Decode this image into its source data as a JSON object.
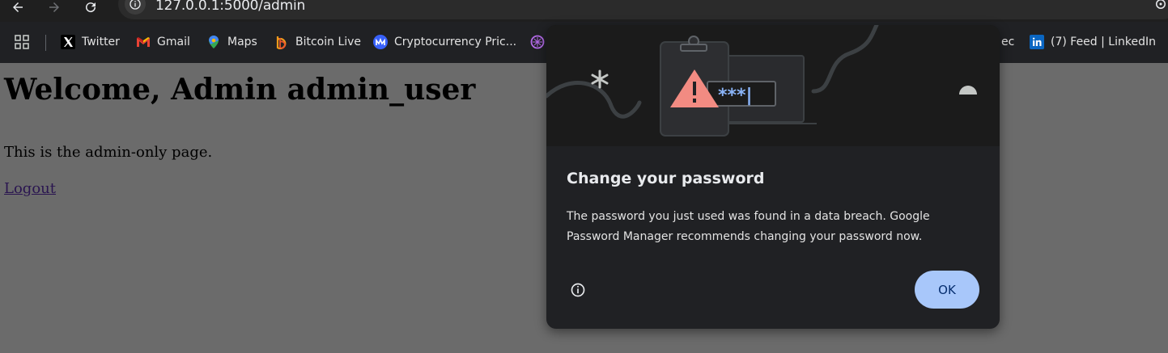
{
  "browser": {
    "url": "127.0.0.1:5000/admin"
  },
  "bookmarks": [
    {
      "label": "Twitter",
      "icon": "x-icon"
    },
    {
      "label": "Gmail",
      "icon": "gmail-icon"
    },
    {
      "label": "Maps",
      "icon": "maps-icon"
    },
    {
      "label": "Bitcoin Live",
      "icon": "bitcoin-live-icon"
    },
    {
      "label": "Cryptocurrency Pric...",
      "icon": "coinmarketcap-icon"
    },
    {
      "label": "ec",
      "icon": ""
    },
    {
      "label": "(7) Feed | LinkedIn",
      "icon": "linkedin-icon"
    }
  ],
  "page": {
    "heading": "Welcome, Admin admin_user",
    "text": "This is the admin-only page.",
    "logout": "Logout"
  },
  "dialog": {
    "title": "Change your password",
    "body": "The password you just used was found in a data breach. Google Password Manager recommends changing your password now.",
    "ok_label": "OK",
    "password_mask": "***|"
  },
  "colors": {
    "accent": "#a8c7fa",
    "dialog_bg": "#202124",
    "warning": "#f28b82"
  }
}
